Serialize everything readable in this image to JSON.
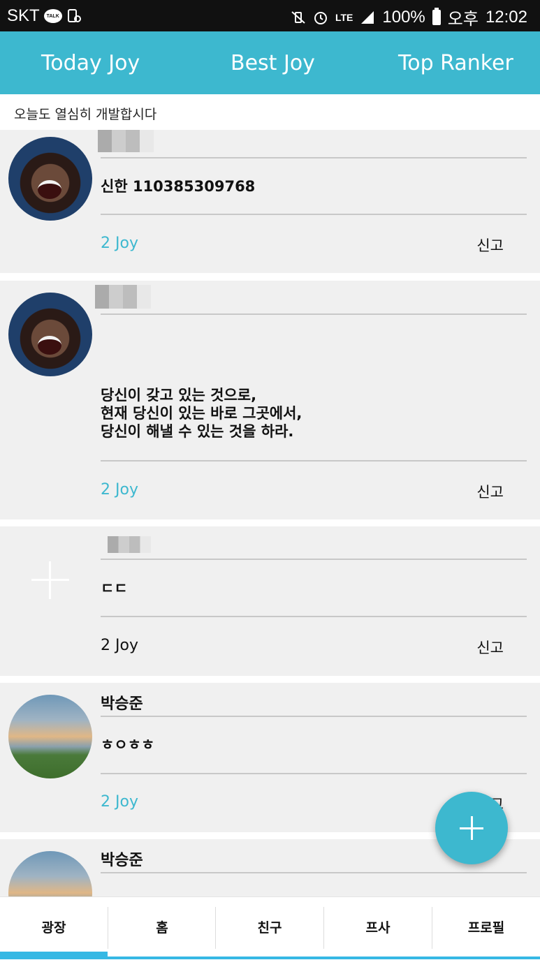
{
  "status_bar": {
    "carrier": "SKT",
    "talk_badge": "TALK",
    "network": "LTE",
    "battery": "100%",
    "ampm": "오후",
    "time": "12:02",
    "icons": [
      "kakaotalk-icon",
      "phone-sync-icon",
      "vibrate-icon",
      "alarm-icon",
      "lte-icon",
      "signal-icon",
      "battery-icon"
    ]
  },
  "top_tabs": [
    "Today Joy",
    "Best Joy",
    "Top Ranker"
  ],
  "notice": "오늘도 열심히 개발합시다",
  "posts": [
    {
      "author": "",
      "content": "신한  110385309768",
      "joy": "2 Joy",
      "report": "신고"
    },
    {
      "author": "",
      "content": "당신이 갖고 있는 것으로,\n현재 당신이 있는 바로 그곳에서,\n당신이 해낼 수 있는 것을 하라.",
      "joy": "2 Joy",
      "report": "신고"
    },
    {
      "author": "",
      "content": "ㄷㄷ",
      "joy": "2 Joy",
      "report": "신고"
    },
    {
      "author": "박승준",
      "content": "ㅎㅇㅎㅎ",
      "joy": "2 Joy",
      "report": "신고"
    },
    {
      "author": "박승준",
      "content": "",
      "joy": "",
      "report": ""
    }
  ],
  "fab_icon": "plus-icon",
  "bottom_nav": [
    "광장",
    "홈",
    "친구",
    "프사",
    "프로필"
  ],
  "colors": {
    "accent": "#3db8cf",
    "active_tab": "#35b8e4",
    "card_bg": "#f0f0f0"
  }
}
